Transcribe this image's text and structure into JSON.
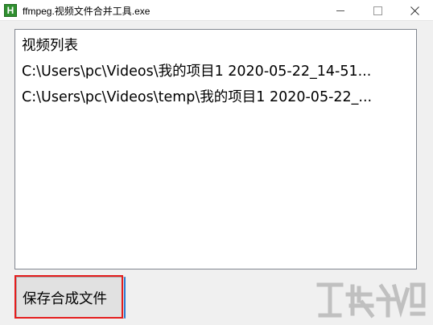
{
  "window": {
    "title": "ffmpeg.视频文件合并工具.exe",
    "icon_letter": "H",
    "icon": "app-icon",
    "buttons": [
      "minimize-icon",
      "maximize-icon",
      "close-icon"
    ]
  },
  "listbox": {
    "header": "视频列表",
    "items": [
      "C:\\Users\\pc\\Videos\\我的项目1 2020-05-22_14-51...",
      "C:\\Users\\pc\\Videos\\temp\\我的项目1 2020-05-22_..."
    ]
  },
  "actions": {
    "save_label": "保存合成文件"
  },
  "colors": {
    "highlight": "#e41e1e",
    "focus_border": "#2b7cd3",
    "window_bg": "#f0f0f0"
  }
}
